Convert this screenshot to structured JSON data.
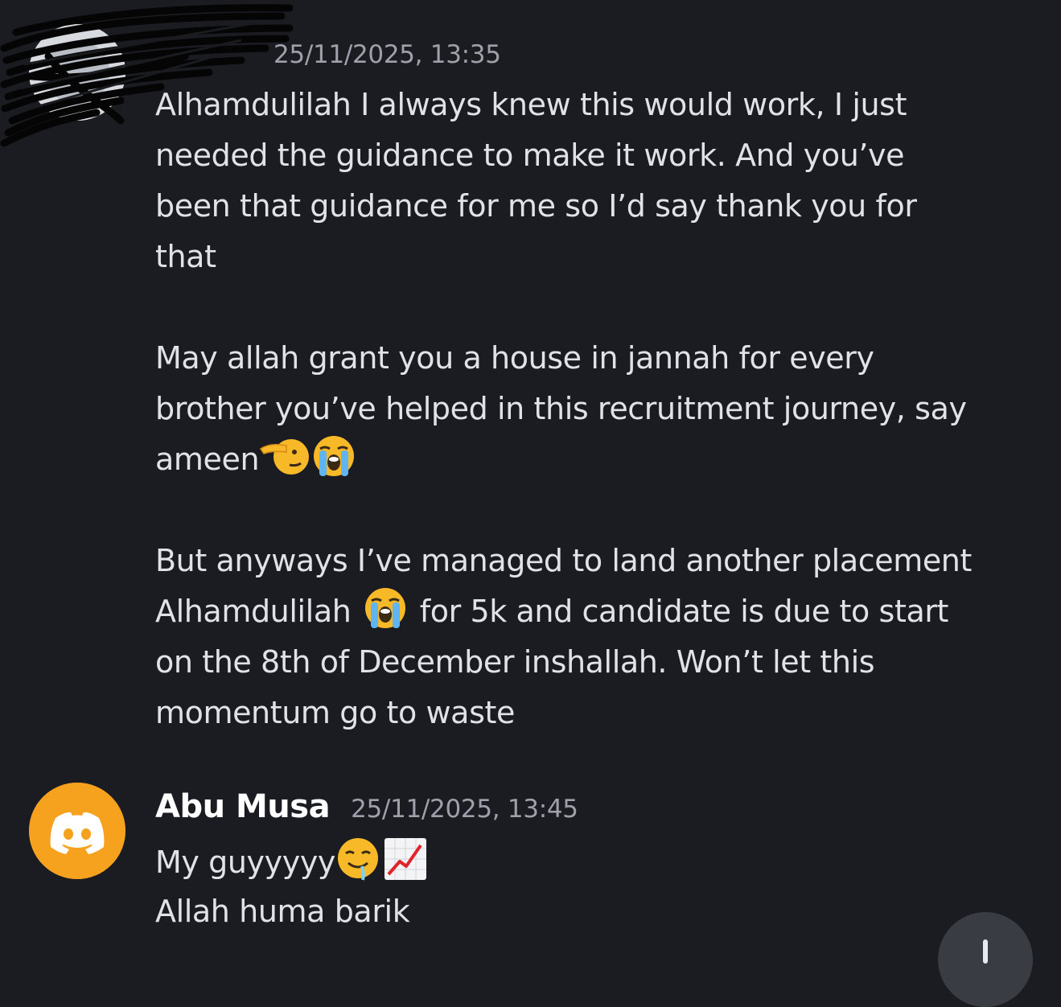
{
  "messages": [
    {
      "author": "",
      "timestamp": "25/11/2025, 13:35",
      "paragraphs": [
        {
          "lines": [
            "Alhamdulilah I always knew this would work, I just",
            "needed the guidance to make it work. And you’ve",
            "been that guidance for me so I’d say thank you for",
            "that"
          ]
        },
        {
          "lines": [
            "May allah grant you a house in jannah for every",
            "brother you’ve helped in this recruitment journey, say",
            "ameen"
          ],
          "trailing_emojis": [
            "pointing-saluting-face-emoji",
            "loudly-crying-face-emoji"
          ]
        },
        {
          "lines": [
            "But anyways I’ve managed to land another placement",
            "Alhamdulilah",
            " for 5k and candidate is due to start",
            "on the 8th of December inshallah. Won’t let this",
            "momentum go to waste"
          ],
          "inline_emoji": "loudly-crying-face-emoji"
        }
      ]
    },
    {
      "author": "Abu Musa",
      "timestamp": "25/11/2025, 13:45",
      "avatar_color": "#f6a21e",
      "lines": [
        "My guyyyyy",
        "Allah huma barik"
      ],
      "trailing_emojis": [
        "drooling-face-emoji",
        "chart-increasing-emoji"
      ]
    }
  ],
  "colors": {
    "background": "#1b1c22",
    "text": "#e1e2e7",
    "timestamp": "#9ea1ab",
    "author": "#ffffff",
    "discord_avatar": "#f6a21e",
    "fab": "#3a3c44"
  },
  "icons": {
    "discord": "discord-logo-icon",
    "fab": "arrow-down-icon"
  }
}
